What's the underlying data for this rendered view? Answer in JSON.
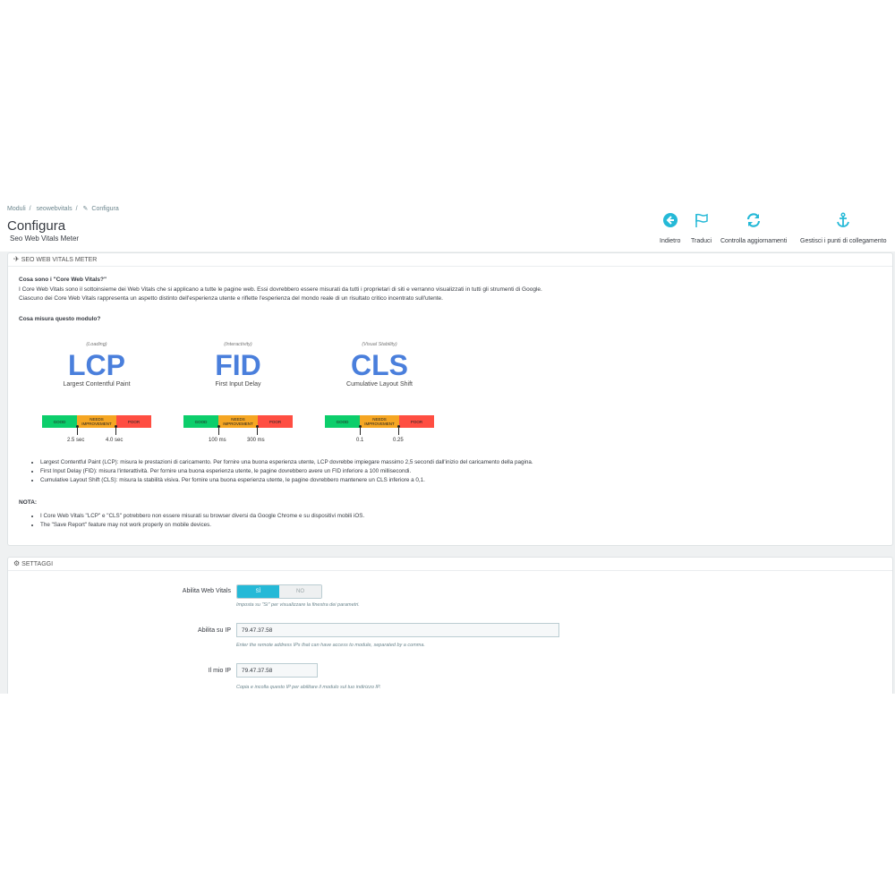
{
  "breadcrumb": [
    "Moduli",
    "seowebvitals",
    "Configura"
  ],
  "page": {
    "title": "Configura",
    "subtitle": "Seo Web Vitals Meter"
  },
  "toolbar": [
    {
      "label": "Indietro",
      "icon": "back-arrow-icon"
    },
    {
      "label": "Traduci",
      "icon": "flag-icon"
    },
    {
      "label": "Controlla aggiornamenti",
      "icon": "refresh-icon"
    },
    {
      "label": "Gestisci i punti di collegamento",
      "icon": "anchor-icon"
    }
  ],
  "meter_panel": {
    "heading": "SEO WEB VITALS METER",
    "q1": "Cosa sono i \"Core Web Vitals?\"",
    "p1": "I Core Web Vitals sono il sottoinsieme dei Web Vitals che si applicano a tutte le pagine web. Essi dovrebbero essere misurati da tutti i proprietari di siti e verranno visualizzati in tutti gli strumenti di Google.",
    "p2": "Ciascuno dei Core Web Vitals rappresenta un aspetto distinto dell'esperienza utente e riflette l'esperienza del mondo reale di un risultato critico incentrato sull'utente.",
    "q2": "Cosa misura questo modulo?",
    "metrics": [
      {
        "category": "(Loading)",
        "abbr": "LCP",
        "name": "Largest Contentful Paint",
        "good": "GOOD",
        "mid": "NEEDS IMPROVEMENT",
        "poor": "POOR",
        "t1": "2.5 sec",
        "t2": "4.0 sec"
      },
      {
        "category": "(Interactivity)",
        "abbr": "FID",
        "name": "First Input Delay",
        "good": "GOOD",
        "mid": "NEEDS IMPROVEMENT",
        "poor": "POOR",
        "t1": "100 ms",
        "t2": "300 ms"
      },
      {
        "category": "(Visual Stability)",
        "abbr": "CLS",
        "name": "Cumulative Layout Shift",
        "good": "GOOD",
        "mid": "NEEDS IMPROVEMENT",
        "poor": "POOR",
        "t1": "0.1",
        "t2": "0.25"
      }
    ],
    "bullets": [
      "Largest Contentful Paint (LCP): misura le prestazioni di caricamento. Per fornire una buona esperienza utente, LCP dovrebbe impiegare massimo 2,5 secondi dall'inizio del caricamento della pagina.",
      "First Input Delay (FID): misura l'interattività. Per fornire una buona esperienza utente, le pagine dovrebbero avere un FID inferiore a 100 millisecondi.",
      "Cumulative Layout Shift (CLS): misura la stabilità visiva. Per fornire una buona esperienza utente, le pagine dovrebbero mantenere un CLS inferiore a 0,1."
    ],
    "note_title": "NOTA:",
    "notes": [
      "I Core Web Vitals \"LCP\" e \"CLS\" potrebbero non essere misurati su browser diversi da Google Chrome e su dispositivi mobili iOS.",
      "The \"Save Report\" feature may not work properly on mobile devices."
    ]
  },
  "settings_panel": {
    "heading": "SETTAGGI",
    "enable_label": "Abilita Web Vitals",
    "yes": "SÌ",
    "no": "NO",
    "enable_help": "Imposta su \"Sì\" per visualizzare la finestra dei parametri.",
    "ip_label": "Abilita su IP",
    "ip_value": "79.47.37.58",
    "ip_help": "Enter the remote address IPs that can have access to module, separated by a comma.",
    "myip_label": "Il mio IP",
    "myip_value": "79.47.37.58",
    "myip_help": "Copia e incolla questo IP per abilitare il modulo sul tuo indirizzo IP."
  }
}
